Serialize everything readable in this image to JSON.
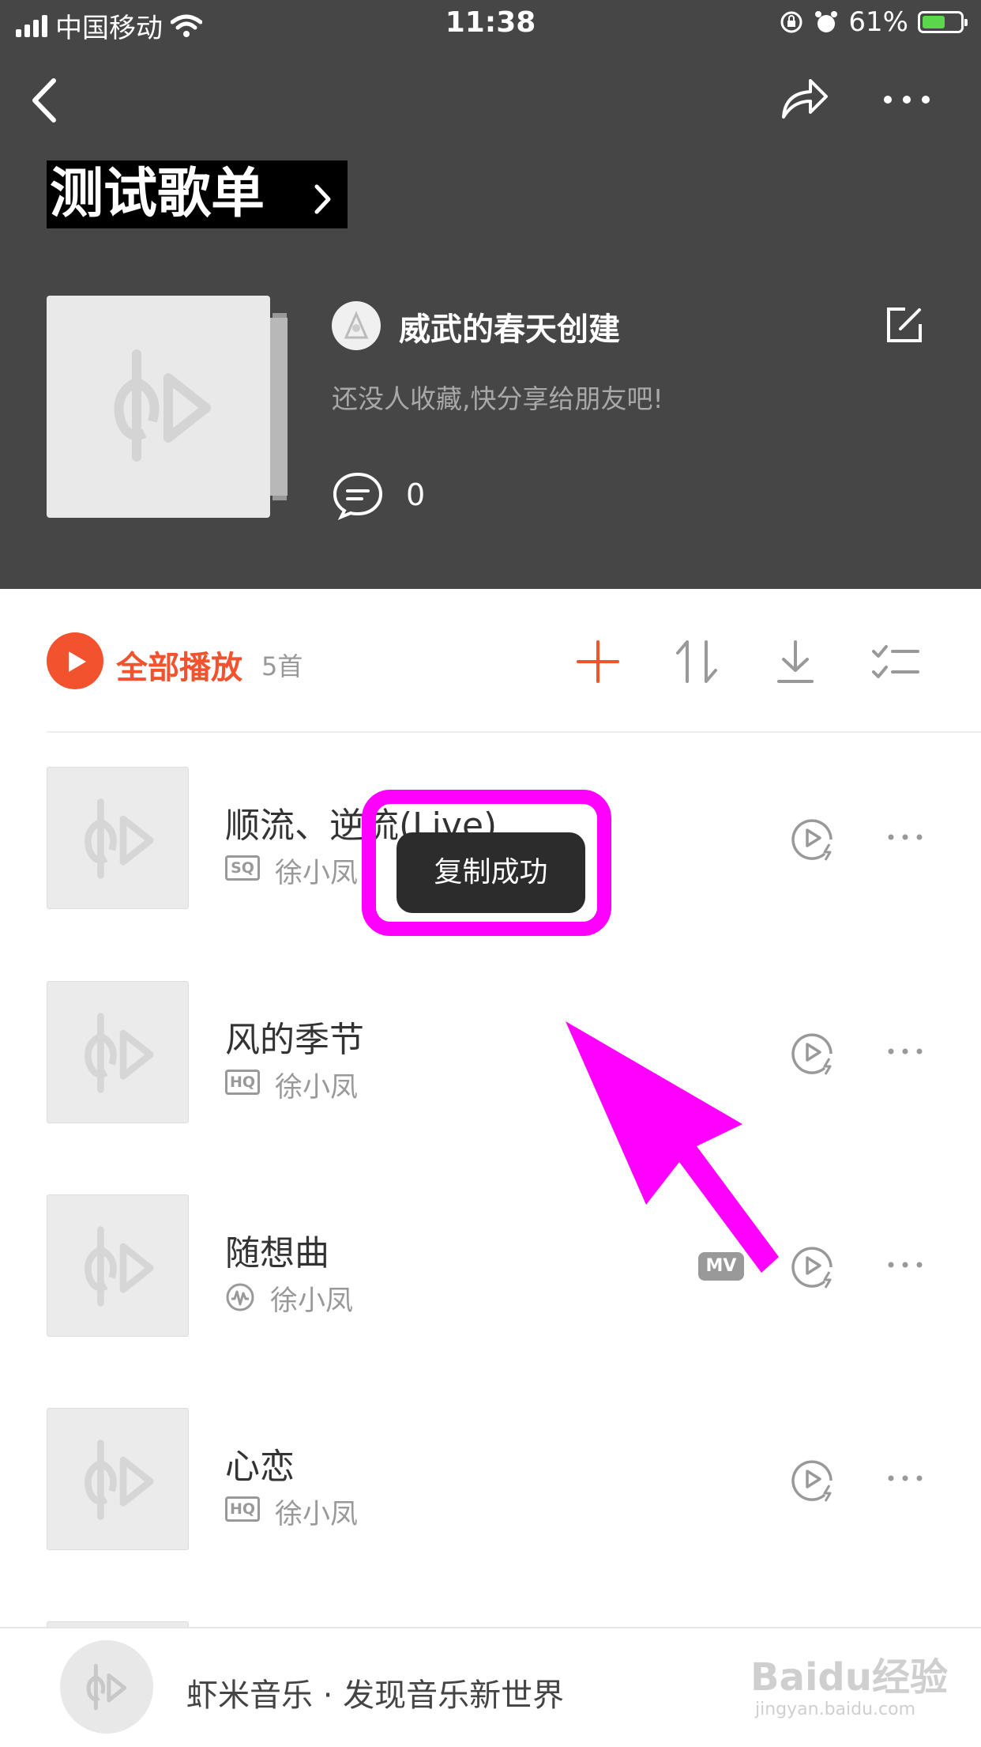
{
  "status_bar": {
    "carrier": "中国移动",
    "time": "11:38",
    "battery": "61%",
    "battery_level": 0.61
  },
  "playlist": {
    "title": "测试歌单",
    "creator": "威武的春天创建",
    "subtitle": "还没人收藏,快分享给朋友吧!",
    "comment_count": "0"
  },
  "toolbar": {
    "play_all_label": "全部播放",
    "song_count": "5首",
    "icons": [
      "add-icon",
      "sort-icon",
      "download-icon",
      "multi-select-icon"
    ]
  },
  "songs": [
    {
      "title": "顺流、逆流(Live)",
      "quality": "SQ",
      "artist": "徐小凤",
      "mv": false
    },
    {
      "title": "风的季节",
      "quality": "HQ",
      "artist": "徐小凤",
      "mv": false
    },
    {
      "title": "随想曲",
      "quality": "",
      "artist": "徐小凤",
      "mv": true,
      "mv_label": "MV"
    },
    {
      "title": "心恋",
      "quality": "HQ",
      "artist": "徐小凤",
      "mv": false
    }
  ],
  "toast": {
    "text": "复制成功"
  },
  "mini_player": {
    "text": "虾米音乐 · 发现音乐新世界"
  },
  "watermark": {
    "text": "Baidu经验",
    "sub": "jingyan.baidu.com"
  },
  "colors": {
    "accent": "#f2522e",
    "header_bg": "#464646",
    "highlight": "#ff00ff"
  }
}
